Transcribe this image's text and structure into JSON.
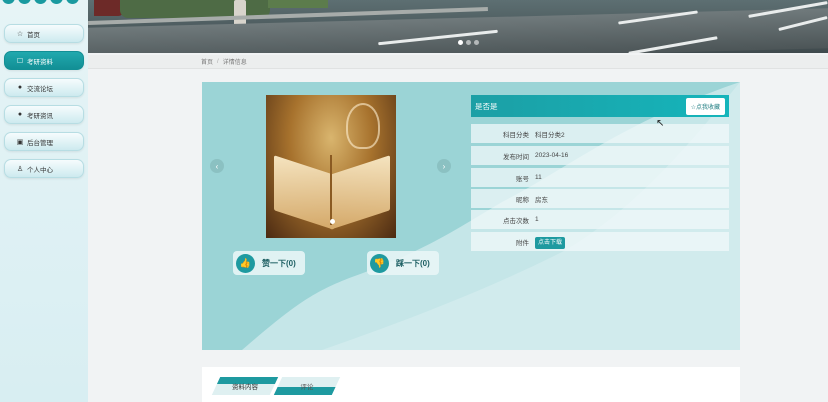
{
  "sidebar": {
    "items": [
      {
        "label": "首页",
        "icon": "star-icon",
        "glyph": "☆",
        "active": false
      },
      {
        "label": "考研资料",
        "icon": "bag-icon",
        "glyph": "☐",
        "active": true
      },
      {
        "label": "交流论坛",
        "icon": "info-icon",
        "glyph": "●",
        "active": false
      },
      {
        "label": "考研资讯",
        "icon": "info-icon",
        "glyph": "●",
        "active": false
      },
      {
        "label": "后台管理",
        "icon": "briefcase-icon",
        "glyph": "▣",
        "active": false
      },
      {
        "label": "个人中心",
        "icon": "user-icon",
        "glyph": "♙",
        "active": false
      }
    ]
  },
  "breadcrumb": {
    "home": "首页",
    "separator": "/",
    "current": "详情信息"
  },
  "detail": {
    "title": "是否是",
    "favorite_label": "☆点我收藏",
    "fields": [
      {
        "key": "科目分类",
        "value": "科目分类2"
      },
      {
        "key": "发布时间",
        "value": "2023-04-16"
      },
      {
        "key": "账号",
        "value": "11"
      },
      {
        "key": "昵称",
        "value": "房东"
      },
      {
        "key": "点击次数",
        "value": "1"
      }
    ],
    "attachment_label": "附件",
    "download_label": "点击下载",
    "like_label": "赞一下(0)",
    "dislike_label": "踩一下(0)"
  },
  "tabs": [
    {
      "label": "资料内容",
      "active": true
    },
    {
      "label": "评论",
      "active": false
    }
  ],
  "colors": {
    "accent": "#1e9aa0",
    "card_bg": "#9bd4d6"
  }
}
